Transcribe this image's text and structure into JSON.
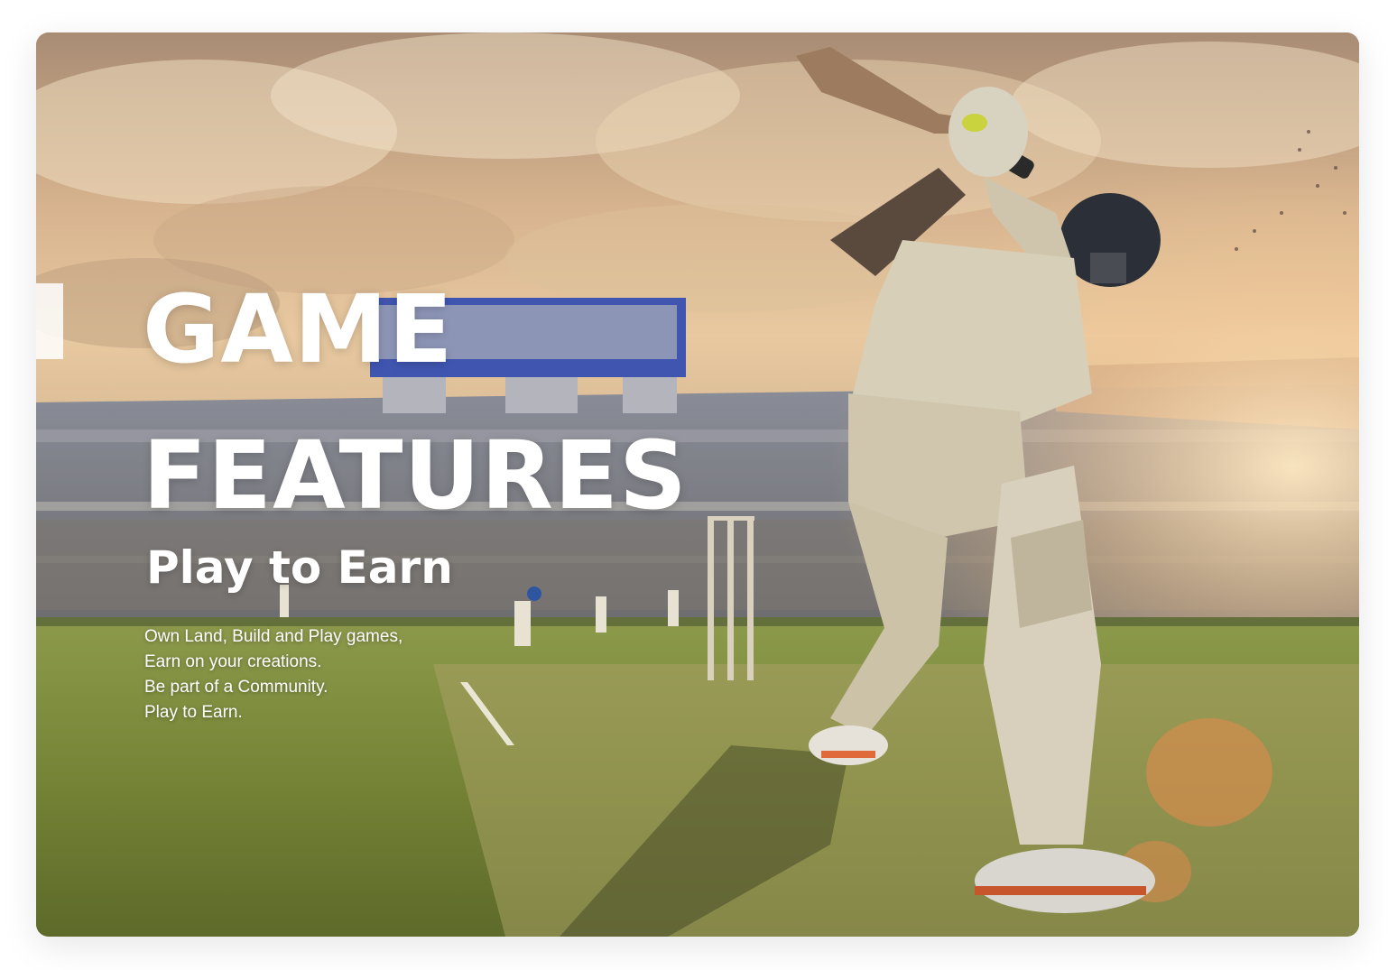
{
  "hero": {
    "title_line1": "GAME",
    "title_line2": "FEATURES",
    "subtitle": "Play to Earn",
    "body_lines": [
      "Own Land, Build and Play games,",
      "Earn on your creations.",
      "Be part of a Community.",
      "Play to Earn."
    ]
  },
  "colors": {
    "text": "#ffffff",
    "sky": "#d9b690",
    "grass": "#7f8f3f",
    "stand_roof_accent": "#4a5fb0",
    "kit": "#d8d0bc"
  }
}
